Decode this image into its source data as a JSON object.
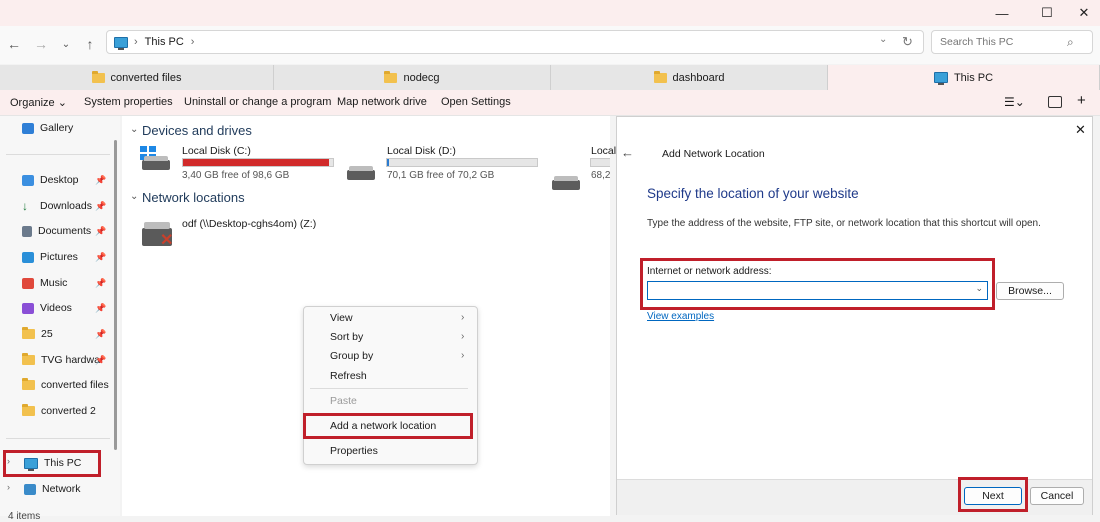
{
  "window": {
    "minimize": "—",
    "maximize": "☐",
    "close": "✕"
  },
  "address": {
    "location": "This PC",
    "sep": "›",
    "search_placeholder": "Search This PC"
  },
  "tabs": [
    {
      "label": "converted files"
    },
    {
      "label": "nodecg"
    },
    {
      "label": "dashboard"
    },
    {
      "label": "This PC"
    }
  ],
  "toolbar": {
    "organize": "Organize ⌄",
    "system_properties": "System properties",
    "uninstall": "Uninstall or change a program",
    "map_drive": "Map network drive",
    "open_settings": "Open Settings"
  },
  "sidebar": {
    "gallery": "Gallery",
    "items": [
      {
        "label": "Desktop"
      },
      {
        "label": "Downloads"
      },
      {
        "label": "Documents"
      },
      {
        "label": "Pictures"
      },
      {
        "label": "Music"
      },
      {
        "label": "Videos"
      },
      {
        "label": "25"
      },
      {
        "label": "TVG hardwar"
      },
      {
        "label": "converted files"
      },
      {
        "label": "converted 2"
      }
    ],
    "this_pc": "This PC",
    "network": "Network"
  },
  "content": {
    "devices_heading": "Devices and drives",
    "drives": [
      {
        "name": "Local Disk (C:)",
        "free": "3,40 GB free of 98,6 GB",
        "used_fraction": 0.97
      },
      {
        "name": "Local Disk (D:)",
        "free": "70,1 GB free of 70,2 GB",
        "used_fraction": 0.01
      },
      {
        "name": "Local",
        "free": "68,2"
      }
    ],
    "network_heading": "Network locations",
    "network_item": "odf (\\\\Desktop-cghs4om) (Z:)"
  },
  "context_menu": {
    "view": "View",
    "sort_by": "Sort by",
    "group_by": "Group by",
    "refresh": "Refresh",
    "paste": "Paste",
    "add_network_location": "Add a network location",
    "properties": "Properties"
  },
  "dialog": {
    "title": "Add Network Location",
    "heading": "Specify the location of your website",
    "description": "Type the address of the website, FTP site, or network location that this shortcut will open.",
    "address_label": "Internet or network address:",
    "address_value": "",
    "browse": "Browse...",
    "view_examples": "View examples",
    "next": "Next",
    "cancel": "Cancel"
  },
  "status": {
    "items": "4 items"
  },
  "colors": {
    "accent": "#0067c0",
    "highlight_box": "#c01f2a",
    "disk_used": "#d12a2a"
  }
}
